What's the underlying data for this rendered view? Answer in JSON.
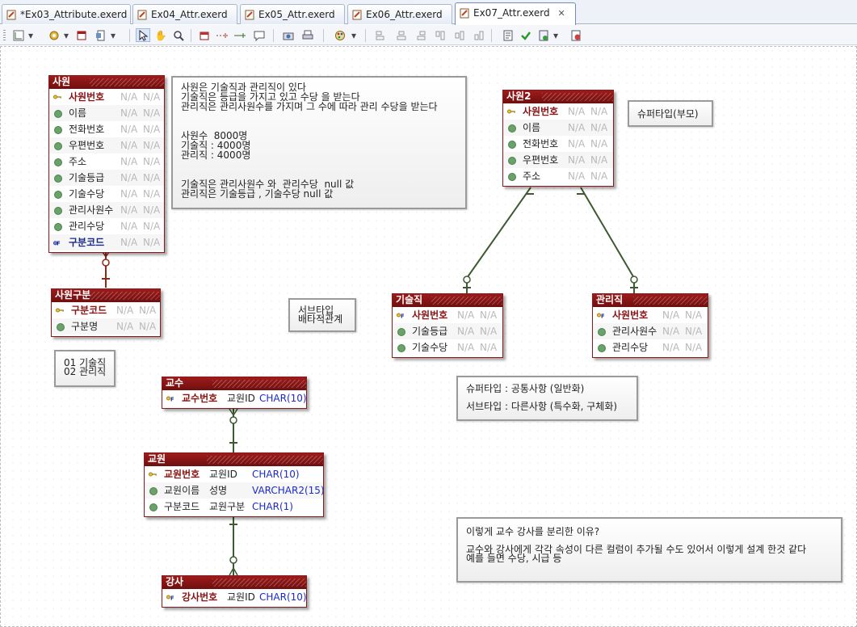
{
  "tabs": [
    {
      "label": "*Ex03_Attribute.exerd",
      "active": false
    },
    {
      "label": "Ex04_Attr.exerd",
      "active": false
    },
    {
      "label": "Ex05_Attr.exerd",
      "active": false
    },
    {
      "label": "Ex06_Attr.exerd",
      "active": false
    },
    {
      "label": "Ex07_Attr.exerd",
      "active": true
    }
  ],
  "tab_close_glyph": "✕",
  "entities": {
    "employee": {
      "title": "사원",
      "rows": [
        {
          "name": "사원번호",
          "logical": "N/A",
          "type": "N/A",
          "key": "pk"
        },
        {
          "name": "이름",
          "logical": "N/A",
          "type": "N/A",
          "key": "col"
        },
        {
          "name": "전화번호",
          "logical": "N/A",
          "type": "N/A",
          "key": "col"
        },
        {
          "name": "우편번호",
          "logical": "N/A",
          "type": "N/A",
          "key": "col"
        },
        {
          "name": "주소",
          "logical": "N/A",
          "type": "N/A",
          "key": "col"
        },
        {
          "name": "기술등급",
          "logical": "N/A",
          "type": "N/A",
          "key": "col"
        },
        {
          "name": "기술수당",
          "logical": "N/A",
          "type": "N/A",
          "key": "col"
        },
        {
          "name": "관리사원수",
          "logical": "N/A",
          "type": "N/A",
          "key": "col"
        },
        {
          "name": "관리수당",
          "logical": "N/A",
          "type": "N/A",
          "key": "col"
        },
        {
          "name": "구분코드",
          "logical": "N/A",
          "type": "N/A",
          "key": "fk"
        }
      ]
    },
    "employee_type": {
      "title": "사원구분",
      "rows": [
        {
          "name": "구분코드",
          "logical": "N/A",
          "type": "N/A",
          "key": "pk"
        },
        {
          "name": "구분명",
          "logical": "N/A",
          "type": "N/A",
          "key": "col"
        }
      ]
    },
    "employee2": {
      "title": "사원2",
      "rows": [
        {
          "name": "사원번호",
          "logical": "N/A",
          "type": "N/A",
          "key": "pk"
        },
        {
          "name": "이름",
          "logical": "N/A",
          "type": "N/A",
          "key": "col"
        },
        {
          "name": "전화번호",
          "logical": "N/A",
          "type": "N/A",
          "key": "col"
        },
        {
          "name": "우편번호",
          "logical": "N/A",
          "type": "N/A",
          "key": "col"
        },
        {
          "name": "주소",
          "logical": "N/A",
          "type": "N/A",
          "key": "col"
        }
      ]
    },
    "tech": {
      "title": "기술직",
      "rows": [
        {
          "name": "사원번호",
          "logical": "N/A",
          "type": "N/A",
          "key": "pkfk"
        },
        {
          "name": "기술등급",
          "logical": "N/A",
          "type": "N/A",
          "key": "col"
        },
        {
          "name": "기술수당",
          "logical": "N/A",
          "type": "N/A",
          "key": "col"
        }
      ]
    },
    "manager": {
      "title": "관리직",
      "rows": [
        {
          "name": "사원번호",
          "logical": "N/A",
          "type": "N/A",
          "key": "pkfk"
        },
        {
          "name": "관리사원수",
          "logical": "N/A",
          "type": "N/A",
          "key": "col"
        },
        {
          "name": "관리수당",
          "logical": "N/A",
          "type": "N/A",
          "key": "col"
        }
      ]
    },
    "professor": {
      "title": "교수",
      "rows": [
        {
          "name": "교수번호",
          "logical": "교원ID",
          "type": "CHAR(10)",
          "key": "pkfk"
        }
      ]
    },
    "faculty": {
      "title": "교원",
      "rows": [
        {
          "name": "교원번호",
          "logical": "교원ID",
          "type": "CHAR(10)",
          "key": "pk"
        },
        {
          "name": "교원이름",
          "logical": "성명",
          "type": "VARCHAR2(15)",
          "key": "col"
        },
        {
          "name": "구분코드",
          "logical": "교원구분",
          "type": "CHAR(1)",
          "key": "col"
        }
      ]
    },
    "lecturer": {
      "title": "강사",
      "rows": [
        {
          "name": "강사번호",
          "logical": "교원ID",
          "type": "CHAR(10)",
          "key": "pkfk"
        }
      ]
    }
  },
  "notes": {
    "main": "사원은 기술직과 관리직이 있다\n기술직은 등급을 가지고 있고 수당 을 받는다\n관리직은 관리사원수를 가지며 그 수에 따라 관리 수당을 받는다\n\n\n사원수  8000명\n기술직 : 4000명\n관리직 : 4000명\n\n\n기술직은 관리사원수 와  관리수당  null 값\n관리직은 기술등급 , 기술수당 null 값",
    "codes": "01 기술직\n02 관리직",
    "subtype": "서브타입\n배타적관계",
    "supertype_parent": "슈퍼타입(부모)",
    "super_sub": "슈퍼타입 : 공통사항 (일반화)\n\n서브타입 : 다른사항 (특수화, 구체화)",
    "reason": "이렇게 교수 강사를 분리한 이유?\n\n교수와 강사에게 각각 속성이 다른 컬럼이 추가될 수도 있어서 이렇게 설계 한것 같다\n예를 들면 수당, 시급 등"
  },
  "colors": {
    "entity_header": "#8a1414",
    "primary_key": "#8a1111",
    "foreign_key": "#1a2a8a",
    "relation_employee": "#8a2a1a",
    "relation_other": "#3d5a32",
    "na_text": "#b9b9b9",
    "type_text": "#1a2ad0"
  }
}
